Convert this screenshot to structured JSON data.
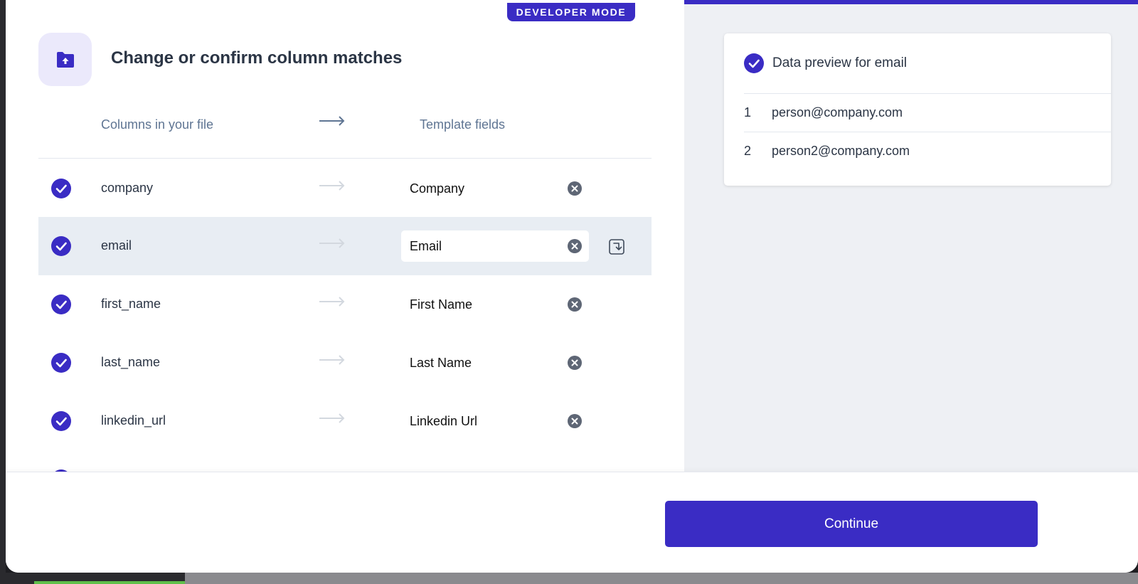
{
  "badge": {
    "label": "DEVELOPER MODE"
  },
  "header": {
    "title": "Change or confirm column matches",
    "icon": "folder-upload-icon"
  },
  "columns": {
    "file_header": "Columns in your file",
    "template_header": "Template fields"
  },
  "rows": [
    {
      "source": "company",
      "target": "Company",
      "matched": true
    },
    {
      "source": "email",
      "target": "Email",
      "matched": true,
      "selected": true
    },
    {
      "source": "first_name",
      "target": "First Name",
      "matched": true
    },
    {
      "source": "last_name",
      "target": "Last Name",
      "matched": true
    },
    {
      "source": "linkedin_url",
      "target": "Linkedin Url",
      "matched": true
    }
  ],
  "preview": {
    "title": "Data preview for email",
    "rows": [
      {
        "index": "1",
        "value": "person@company.com"
      },
      {
        "index": "2",
        "value": "person2@company.com"
      }
    ]
  },
  "footer": {
    "continue_label": "Continue"
  },
  "colors": {
    "accent": "#3a2cc4",
    "text": "#2b3545",
    "muted": "#5f7593",
    "panel": "#eef0f4",
    "highlight": "#e8edf3"
  }
}
